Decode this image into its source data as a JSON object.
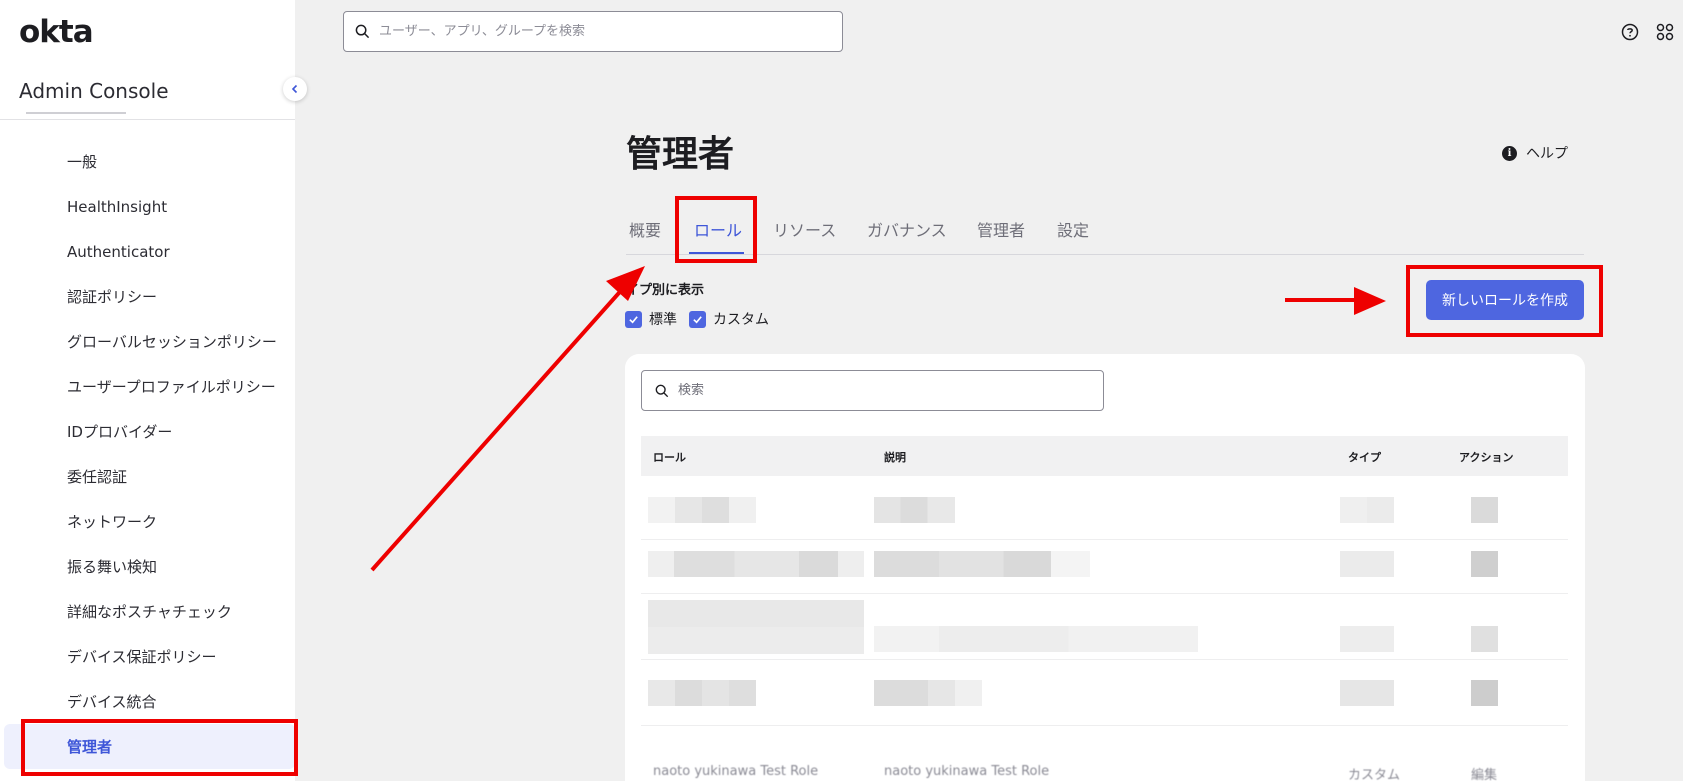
{
  "sidebar": {
    "logo": "okta",
    "console_title": "Admin Console",
    "items": [
      {
        "label": "一般"
      },
      {
        "label": "HealthInsight"
      },
      {
        "label": "Authenticator"
      },
      {
        "label": "認証ポリシー"
      },
      {
        "label": "グローバルセッションポリシー"
      },
      {
        "label": "ユーザープロファイルポリシー"
      },
      {
        "label": "IDプロバイダー"
      },
      {
        "label": "委任認証"
      },
      {
        "label": "ネットワーク"
      },
      {
        "label": "振る舞い検知"
      },
      {
        "label": "詳細なポスチャチェック"
      },
      {
        "label": "デバイス保証ポリシー"
      },
      {
        "label": "デバイス統合"
      },
      {
        "label": "管理者",
        "active": true
      }
    ]
  },
  "topbar": {
    "search_placeholder": "ユーザー、アプリ、グループを検索"
  },
  "main": {
    "title": "管理者",
    "help_label": "ヘルプ",
    "tabs": [
      {
        "label": "概要"
      },
      {
        "label": "ロール",
        "active": true
      },
      {
        "label": "リソース"
      },
      {
        "label": "ガバナンス"
      },
      {
        "label": "管理者"
      },
      {
        "label": "設定"
      }
    ],
    "filter_label": "イプ別に表示",
    "filters": [
      {
        "label": "標準",
        "checked": true
      },
      {
        "label": "カスタム",
        "checked": true
      }
    ],
    "create_button": "新しいロールを作成",
    "table": {
      "search_placeholder": "検索",
      "columns": [
        "ロール",
        "説明",
        "タイプ",
        "アクション"
      ],
      "last_row": {
        "role": "naoto yukinawa Test Role",
        "description": "naoto yukinawa Test Role",
        "type": "カスタム",
        "action": "編集"
      }
    }
  },
  "colors": {
    "accent": "#4e66e0",
    "annotation": "#e00000"
  }
}
